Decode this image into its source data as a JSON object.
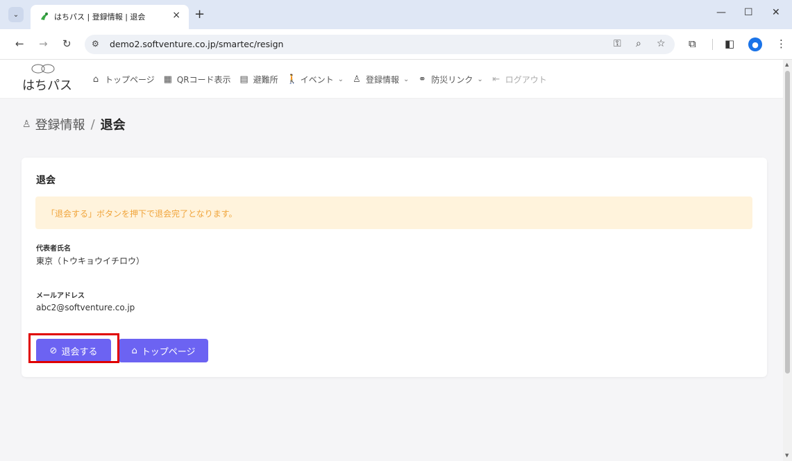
{
  "browser": {
    "tab_title": "はちパス | 登録情報 | 退会",
    "tab_close": "×",
    "new_tab": "+",
    "url": "demo2.softventure.co.jp/smartec/resign",
    "window_controls": {
      "minimize": "—",
      "maximize": "☐",
      "close": "✕"
    },
    "icons": [
      "back-icon",
      "forward-icon",
      "reload-icon",
      "site-info-icon",
      "key-icon",
      "zoom-icon",
      "star-icon",
      "extensions-icon",
      "side-panel-icon",
      "profile-icon",
      "menu-icon"
    ]
  },
  "header": {
    "logo_text": "はちパス",
    "nav": [
      {
        "label": "トップページ",
        "icon": "home-icon"
      },
      {
        "label": "QRコード表示",
        "icon": "qr-icon"
      },
      {
        "label": "避難所",
        "icon": "building-icon"
      },
      {
        "label": "イベント",
        "icon": "walker-icon",
        "dropdown": true
      },
      {
        "label": "登録情報",
        "icon": "user-icon",
        "dropdown": true
      },
      {
        "label": "防災リンク",
        "icon": "link-icon",
        "dropdown": true
      },
      {
        "label": "ログアウト",
        "icon": "logout-icon",
        "disabled": true
      }
    ]
  },
  "breadcrumb": {
    "parent": "登録情報",
    "separator": "/",
    "current": "退会"
  },
  "card": {
    "title": "退会",
    "alert": "「退会する」ボタンを押下で退会完了となります。",
    "fields": [
      {
        "label": "代表者氏名",
        "value": "東京（トウキョウイチロウ）"
      },
      {
        "label": "メールアドレス",
        "value": "abc2@softventure.co.jp"
      }
    ],
    "buttons": {
      "resign": "退会する",
      "top_page": "トップページ"
    }
  },
  "colors": {
    "primary": "#6c63f2",
    "alert_bg": "#fff3dc",
    "alert_text": "#f0a43a",
    "highlight": "#e00000"
  }
}
